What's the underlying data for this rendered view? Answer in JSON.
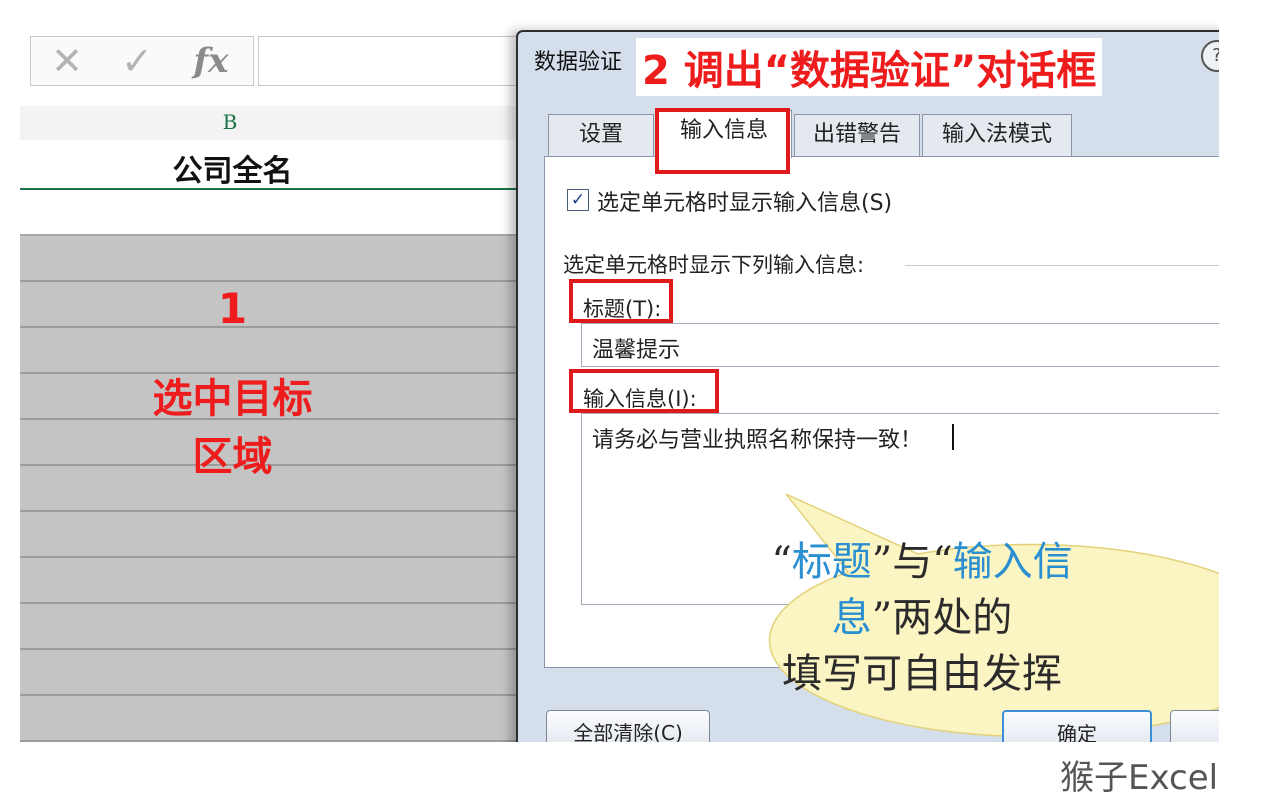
{
  "excel": {
    "formula_bar": {
      "cancel_glyph": "✕",
      "enter_glyph": "✓",
      "fx_glyph": "fx"
    },
    "column_header": "B",
    "header_cell": "公司全名",
    "annotation_step1": {
      "number": "1",
      "line1": "选中目标",
      "line2": "区域"
    }
  },
  "dialog": {
    "title": "数据验证",
    "help_glyph": "?",
    "annotation_step2": "2 调出“数据验证”对话框",
    "tabs": [
      {
        "label": "设置",
        "active": false
      },
      {
        "label": "输入信息",
        "active": true
      },
      {
        "label": "出错警告",
        "active": false
      },
      {
        "label": "输入法模式",
        "active": false
      }
    ],
    "show_checkbox": {
      "checked": true,
      "glyph": "✓",
      "label": "选定单元格时显示输入信息(S)"
    },
    "group_label": "选定单元格时显示下列输入信息:",
    "title_field": {
      "label": "标题(T):",
      "value": "温馨提示"
    },
    "message_field": {
      "label": "输入信息(I):",
      "value": "请务必与营业执照名称保持一致！"
    },
    "callout": {
      "part1": "“",
      "part2": "标题",
      "part3": "”与“",
      "part4": "输入信息",
      "part5": "”两处的",
      "part6": "填写可自由发挥"
    },
    "buttons": {
      "clear_all": "全部清除(C)",
      "ok": "确定"
    }
  },
  "watermark": "猴子Excel",
  "colors": {
    "annotation_red": "#ee1c1c",
    "highlight_red": "#e01a1a",
    "callout_fill": "#fbf4c3",
    "callout_accent": "#2a8fd0",
    "excel_green": "#1e7145",
    "dialog_bg": "#d5dfec"
  },
  "icons": {
    "cancel": "close-icon",
    "enter": "check-icon",
    "function": "fx-icon",
    "help": "help-icon"
  }
}
